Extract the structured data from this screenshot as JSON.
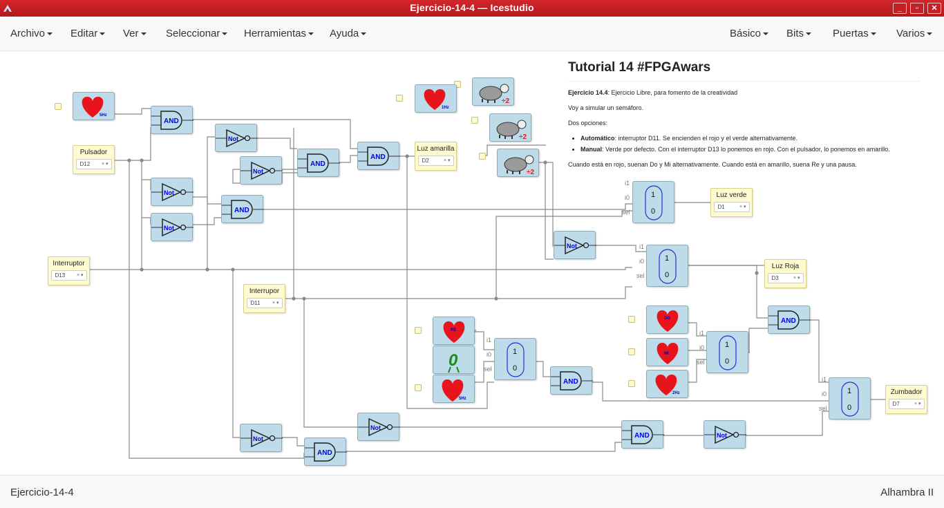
{
  "window": {
    "title": "Ejercicio-14-4 — Icestudio",
    "minimize": "_",
    "maximize": "▫",
    "close": "✕"
  },
  "menu": {
    "left": [
      "Archivo",
      "Editar",
      "Ver",
      "Seleccionar",
      "Herramientas",
      "Ayuda"
    ],
    "right": [
      "Básico",
      "Bits",
      "Puertas",
      "Varios"
    ]
  },
  "description": {
    "title": "Tutorial 14 #FPGAwars",
    "ex_bold": "Ejercicio 14.4",
    "ex_text": ": Ejercicio Libre, para fomento de la creatividad",
    "p2": "Voy a simular un semáforo.",
    "p3": "Dos opciones:",
    "li1_bold": "Automático",
    "li1_text": ": interruptor D11. Se encienden el rojo y el verde alternativamente.",
    "li2_bold": "Manual",
    "li2_text": ": Verde por defecto. Con el interruptor D13 lo ponemos en rojo. Con el pulsador, lo ponemos en amarillo.",
    "p4": "Cuando está en rojo, suenan Do y Mi alternativamente. Cuando está en amarillo, suena Re y una pausa."
  },
  "io": {
    "pulsador": {
      "label": "Pulsador",
      "pin": "D12"
    },
    "interruptor": {
      "label": "Interruptor",
      "pin": "D13"
    },
    "interrupor": {
      "label": "Interrupor",
      "pin": "D11"
    },
    "luz_amarilla": {
      "label": "Luz amarilla",
      "pin": "D2"
    },
    "luz_verde": {
      "label": "Luz verde",
      "pin": "D1"
    },
    "luz_roja": {
      "label": "Luz Roja",
      "pin": "D3"
    },
    "zumbador": {
      "label": "Zumbador",
      "pin": "D7"
    }
  },
  "gates": {
    "and": "AND",
    "not": "Not"
  },
  "mux": {
    "one": "1",
    "zero": "0",
    "i1": "i1",
    "i0": "i0",
    "sel": "sel"
  },
  "clocks": {
    "f5": "5Hz",
    "f1": "1Hz",
    "f2": "2Hz",
    "re": "RE",
    "do": "DO",
    "mi": "MI",
    "div": "÷2"
  },
  "zero_glyph": "0",
  "footer": {
    "left": "Ejercicio-14-4",
    "right": "Alhambra II"
  },
  "colors": {
    "title_bar": "#c41f22",
    "block": "#bddbe8",
    "io": "#fffbd0",
    "heart": "#e8141b",
    "gate_text": "#0000ee",
    "wire": "#888888"
  }
}
